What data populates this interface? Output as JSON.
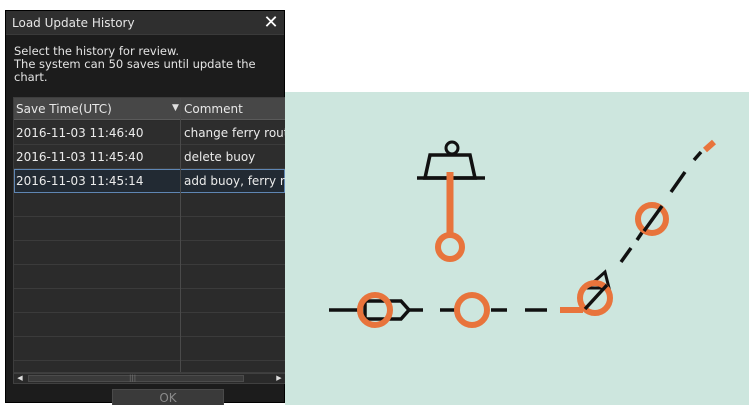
{
  "dialog": {
    "title": "Load Update History",
    "close_glyph": "✕",
    "message_lines": [
      "Select the history for review.",
      "The system can 50 saves until update the",
      "chart."
    ],
    "table": {
      "columns": {
        "time": "Save Time(UTC)",
        "comment": "Comment"
      },
      "rows": [
        {
          "time": "2016-11-03 11:46:40",
          "comment": "change ferry rout"
        },
        {
          "time": "2016-11-03 11:45:40",
          "comment": "delete buoy"
        },
        {
          "time": "2016-11-03 11:45:14",
          "comment": "add buoy, ferry ro"
        }
      ],
      "selected_row_index": 2
    },
    "ok_label": "OK"
  },
  "colors": {
    "dialog_bg": "#1c1c1c",
    "chart_bg": "#cde6de",
    "accent_orange": "#e8743c",
    "selection_border": "#5f86b3"
  }
}
